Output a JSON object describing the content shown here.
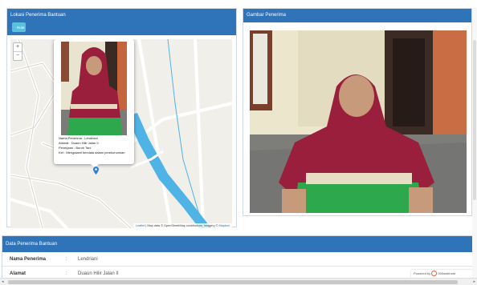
{
  "map_panel": {
    "title": "Lokasi Penerima Bantuan",
    "route_button": "Rute",
    "zoom_in": "+",
    "zoom_out": "−",
    "popup": {
      "line1": "Nama Penerima : Lendriani",
      "line2": "Alamat : Duaun Hilir Jalan II",
      "line3": "Pekerjaan : Buruh Tani",
      "line4": "Ket : Mengalami kendala dalam perekonomian"
    },
    "attribution": {
      "leaflet": "Leaflet",
      "text": " | Map data © OpenStreetMap contributors, Imagery © ",
      "mapbox": "Mapbox"
    }
  },
  "photo_panel": {
    "title": "Gambar Penerima"
  },
  "data_panel": {
    "title": "Data Penerima Bantuan",
    "rows": [
      {
        "label": "Nama Penerima",
        "sep": ":",
        "value": "Lendriani"
      },
      {
        "label": "Alamat",
        "sep": ":",
        "value": "Duaun Hilir Jalan II"
      }
    ]
  },
  "badge": {
    "prefix": "Powered by",
    "brand": "000webhost"
  },
  "colors": {
    "header_blue": "#2f73b8",
    "route_button": "#5bc0de",
    "hijab_red": "#9a1f3c",
    "map_river": "#4fb3e6"
  }
}
